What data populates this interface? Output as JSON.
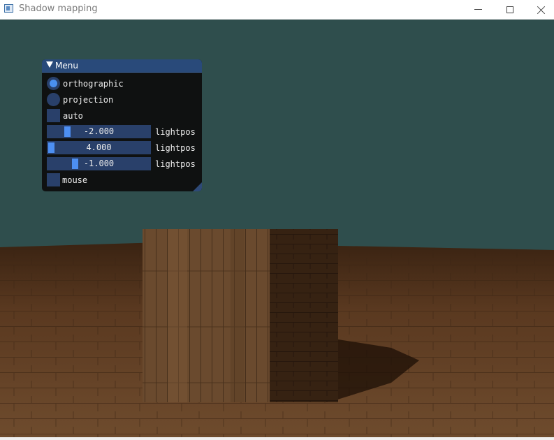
{
  "window": {
    "title": "Shadow mapping",
    "icon": "app-window-icon",
    "controls": [
      "minimize-icon",
      "maximize-icon",
      "close-icon"
    ]
  },
  "scene": {
    "background_color": "#2f4e4d",
    "floor_color": "#5a3c23",
    "cube_color": "#6b4a2f"
  },
  "menu": {
    "title": "Menu",
    "radios": [
      {
        "label": "orthographic",
        "selected": true
      },
      {
        "label": "projection",
        "selected": false
      }
    ],
    "auto": {
      "label": "auto",
      "checked": false
    },
    "sliders": [
      {
        "value": "-2.000",
        "label": "lightpos :",
        "fraction": 0.2
      },
      {
        "value": "4.000",
        "label": "lightpos (",
        "fraction": 0.0
      },
      {
        "value": "-1.000",
        "label": "lightpos :",
        "fraction": 0.3
      }
    ],
    "mouse": {
      "label": "mouse",
      "checked": false
    }
  },
  "colors": {
    "accent": "#4a90f0",
    "frame": "#29406a",
    "title_bar": "#294a7a"
  }
}
